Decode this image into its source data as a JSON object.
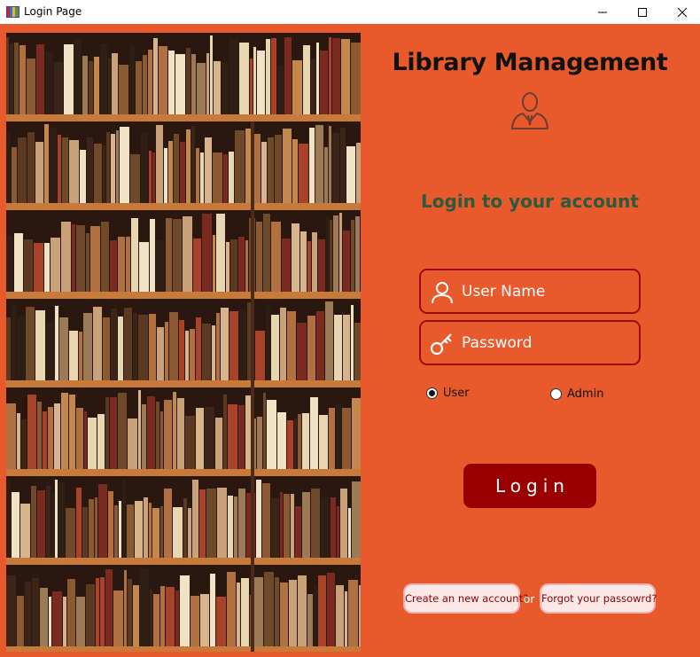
{
  "window": {
    "title": "Login Page",
    "controls": {
      "minimize": "minimize-icon",
      "maximize": "maximize-icon",
      "close": "close-icon"
    }
  },
  "colors": {
    "background": "#e85a2c",
    "title": "#111111",
    "subtitle": "#2b5a3c",
    "field_border": "#9a0d0d",
    "login_button": "#9a0000",
    "link_button_bg": "#fde8e8",
    "link_text": "#8a0000"
  },
  "header": {
    "app_title": "Library Management",
    "avatar_icon": "user-profile-icon",
    "subtitle": "Login to your account"
  },
  "form": {
    "username": {
      "placeholder": "User Name",
      "value": "",
      "icon": "person-icon"
    },
    "password": {
      "placeholder": "Password",
      "value": "",
      "icon": "key-icon"
    },
    "roles": [
      {
        "label": "User",
        "selected": true
      },
      {
        "label": "Admin",
        "selected": false
      }
    ],
    "login_label": "Login"
  },
  "footer": {
    "create_account": "Create an new account?",
    "or": "or",
    "forgot_password": "Forgot your passowrd?"
  }
}
